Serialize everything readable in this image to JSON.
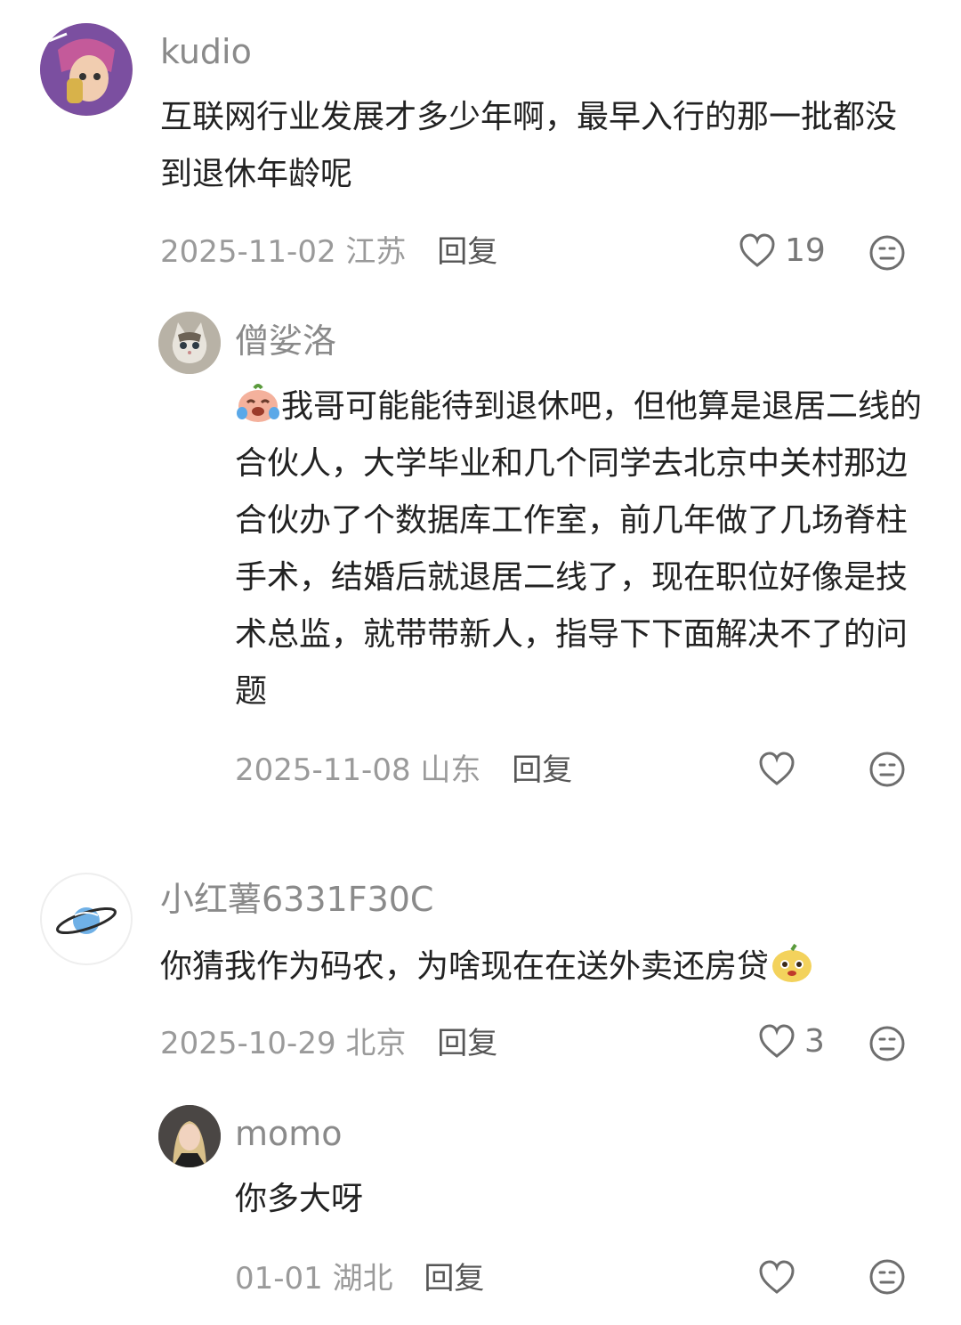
{
  "comments": [
    {
      "username": "kudio",
      "text": "互联网行业发展才多少年啊，最早入行的那一批都没到退休年龄呢",
      "date": "2025-11-02",
      "location": "江苏",
      "reply_label": "回复",
      "likes": "19",
      "avatar_icon": "anime-character-avatar"
    },
    {
      "username": "僧娑洛",
      "text": "我哥可能能待到退休吧，但他算是退居二线的合伙人，大学毕业和几个同学去北京中关村那边合伙办了个数据库工作室，前几年做了几场脊柱手术，结婚后就退居二线了，现在职位好像是技术总监，就带带新人，指导下下面解决不了的问题",
      "date": "2025-11-08",
      "location": "山东",
      "reply_label": "回复",
      "likes": "",
      "avatar_icon": "kitten-avatar"
    },
    {
      "username": "小红薯6331F30C",
      "text": "你猜我作为码农，为啥现在在送外卖还房贷",
      "date": "2025-10-29",
      "location": "北京",
      "reply_label": "回复",
      "likes": "3",
      "avatar_icon": "planet-avatar"
    },
    {
      "username": "momo",
      "text": "你多大呀",
      "date": "01-01",
      "location": "湖北",
      "reply_label": "回复",
      "likes": "",
      "avatar_icon": "person-photo-avatar"
    }
  ],
  "colors": {
    "username": "#8a8a8a",
    "text": "#222222",
    "meta": "#9a9a9a"
  }
}
